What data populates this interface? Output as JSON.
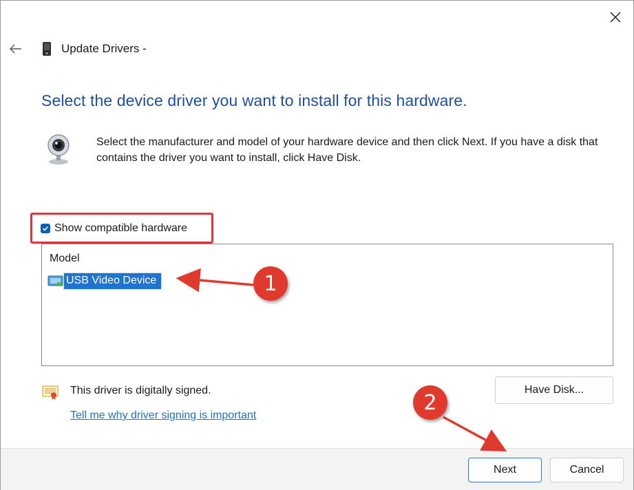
{
  "window": {
    "title": "Update Drivers -",
    "heading": "Select the device driver you want to install for this hardware.",
    "description": "Select the manufacturer and model of your hardware device and then click Next. If you have a disk that contains the driver you want to install, click Have Disk."
  },
  "compatible": {
    "label": "Show compatible hardware",
    "checked": true
  },
  "model_list": {
    "header": "Model",
    "items": [
      {
        "label": "USB Video Device",
        "selected": true
      }
    ]
  },
  "signing": {
    "status": "This driver is digitally signed.",
    "link": "Tell me why driver signing is important"
  },
  "buttons": {
    "have_disk": "Have Disk...",
    "next": "Next",
    "cancel": "Cancel"
  },
  "annotations": {
    "badge_1": "1",
    "badge_2": "2",
    "color": "#e03a2f"
  },
  "colors": {
    "heading": "#1f4e9c",
    "accent": "#0a5fb4",
    "selection": "#1f74cf",
    "link": "#1a73c9"
  }
}
